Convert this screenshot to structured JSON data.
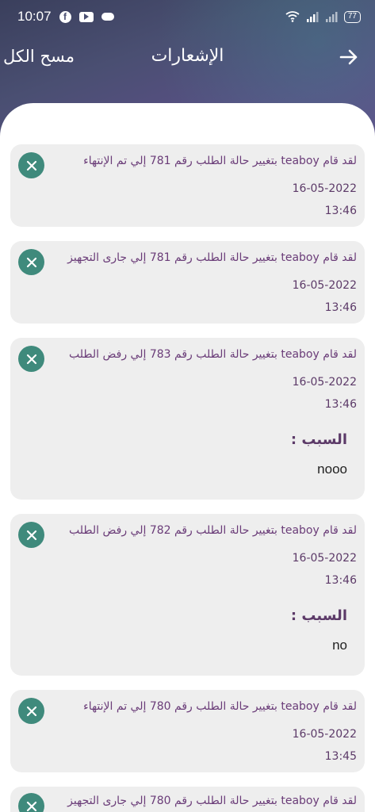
{
  "status_bar": {
    "time": "10:07",
    "battery": "77",
    "icons": [
      "facebook-icon",
      "youtube-icon",
      "cloud-icon",
      "wifi-icon",
      "signal-icon",
      "signal-icon-2",
      "battery-icon"
    ]
  },
  "header": {
    "title": "الإشعارات",
    "clear_all": "مسح الكل",
    "back_icon": "arrow-right-icon"
  },
  "labels": {
    "reason": "السبب :"
  },
  "notifications": [
    {
      "message": "لقد قام teaboy بتغيير حالة الطلب رقم 781 إلي تم الإنتهاء",
      "date": "16-05-2022",
      "time": "13:46"
    },
    {
      "message": "لقد قام teaboy بتغيير حالة الطلب رقم 781 إلي جارى التجهيز",
      "date": "16-05-2022",
      "time": "13:46"
    },
    {
      "message": "لقد قام teaboy بتغيير حالة الطلب رقم 783 إلي رفض الطلب",
      "date": "16-05-2022",
      "time": "13:46",
      "reason": "nooo"
    },
    {
      "message": "لقد قام teaboy بتغيير حالة الطلب رقم 782 إلي رفض الطلب",
      "date": "16-05-2022",
      "time": "13:46",
      "reason": "no"
    },
    {
      "message": "لقد قام teaboy بتغيير حالة الطلب رقم 780 إلي تم الإنتهاء",
      "date": "16-05-2022",
      "time": "13:45"
    },
    {
      "message": "لقد قام teaboy بتغيير حالة الطلب رقم 780 إلي جارى التجهيز",
      "date": "",
      "time": ""
    }
  ],
  "colors": {
    "accent": "#3f8a7c",
    "text_primary": "#6a3c78",
    "card_bg": "#eeeeee"
  }
}
